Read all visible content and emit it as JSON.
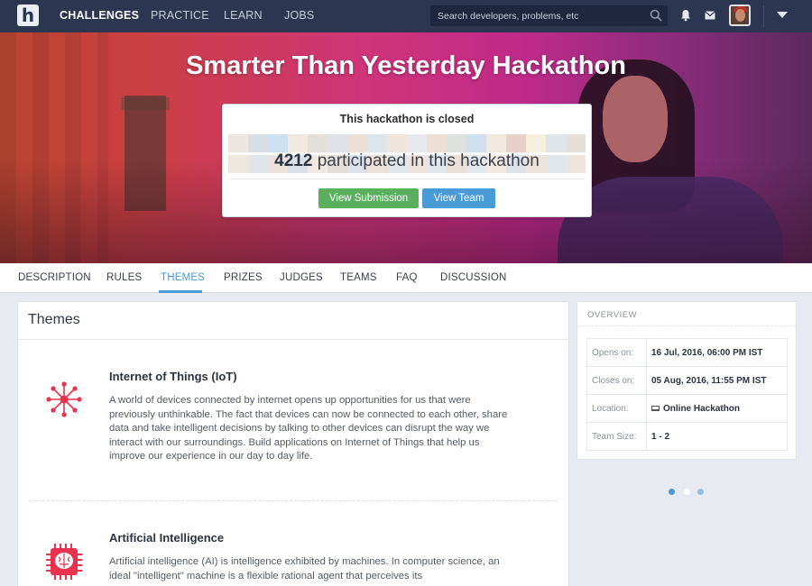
{
  "nav": {
    "logo": "h",
    "links": [
      "CHALLENGES",
      "PRACTICE",
      "LEARN",
      "JOBS"
    ],
    "active_link": "CHALLENGES",
    "search_placeholder": "Search developers, problems, etc"
  },
  "hero": {
    "title": "Smarter Than Yesterday Hackathon",
    "status": "This hackathon is closed",
    "participant_count": "4212",
    "participated_text": "participated in this hackathon",
    "view_submission": "View Submission",
    "view_team": "View Team"
  },
  "tabs": [
    "DESCRIPTION",
    "RULES",
    "THEMES",
    "PRIZES",
    "JUDGES",
    "TEAMS",
    "FAQ",
    "DISCUSSION"
  ],
  "active_tab": "THEMES",
  "themes": {
    "heading": "Themes",
    "items": [
      {
        "icon": "network-nodes-icon",
        "title": "Internet of Things (IoT)",
        "description": "A world of devices connected by internet opens up opportunities for us that were previously unthinkable. The fact that devices can now be connected to each other, share data and take intelligent decisions by talking to other devices can disrupt the way we interact with our surroundings. Build applications on Internet of Things that help us improve our experience in our day to day life."
      },
      {
        "icon": "brain-chip-icon",
        "title": "Artificial Intelligence",
        "description": "Artificial intelligence (AI) is intelligence exhibited by machines. In computer science, an ideal \"intelligent\" machine is a flexible rational agent that perceives its"
      }
    ]
  },
  "overview": {
    "heading": "OVERVIEW",
    "rows": [
      {
        "label": "Opens on:",
        "value": "16 Jul, 2016, 06:00 PM IST"
      },
      {
        "label": "Closes on:",
        "value": "05 Aug, 2016, 11:55 PM IST"
      },
      {
        "label": "Location:",
        "value": "Online Hackathon",
        "icon": "laptop-icon"
      },
      {
        "label": "Team Size:",
        "value": "1 - 2"
      }
    ]
  },
  "carousel": {
    "count": 3,
    "active_index": 0
  },
  "colors": {
    "nav_bg": "#2c3651",
    "accent_blue": "#4a9ad6",
    "button_green": "#5bb060",
    "theme_icon_red": "#e8324f"
  }
}
